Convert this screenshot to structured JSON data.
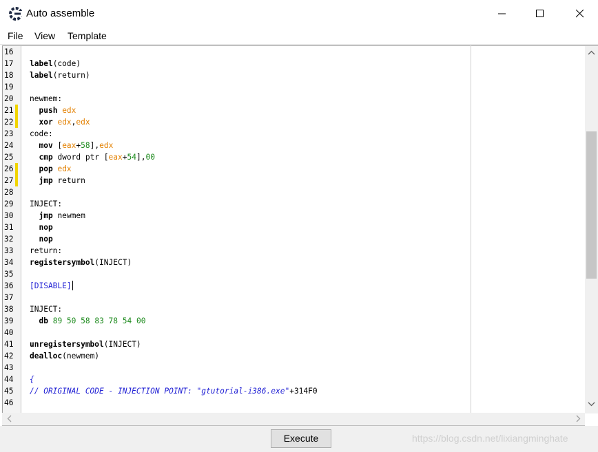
{
  "window": {
    "title": "Auto assemble",
    "min_label": "Minimize",
    "max_label": "Maximize",
    "close_label": "Close"
  },
  "menu": {
    "items": [
      {
        "label": "File"
      },
      {
        "label": "View"
      },
      {
        "label": "Template"
      }
    ]
  },
  "editor": {
    "lines": [
      {
        "n": "16",
        "mark": false,
        "tokens": []
      },
      {
        "n": "17",
        "mark": false,
        "tokens": [
          {
            "t": "kw",
            "v": "label"
          },
          {
            "t": "id",
            "v": "(code)"
          }
        ]
      },
      {
        "n": "18",
        "mark": false,
        "tokens": [
          {
            "t": "kw",
            "v": "label"
          },
          {
            "t": "id",
            "v": "(return)"
          }
        ]
      },
      {
        "n": "19",
        "mark": false,
        "tokens": []
      },
      {
        "n": "20",
        "mark": false,
        "tokens": [
          {
            "t": "id",
            "v": "newmem:"
          }
        ]
      },
      {
        "n": "21",
        "mark": true,
        "tokens": [
          {
            "t": "id",
            "v": "  "
          },
          {
            "t": "kw",
            "v": "push"
          },
          {
            "t": "id",
            "v": " "
          },
          {
            "t": "reg",
            "v": "edx"
          }
        ]
      },
      {
        "n": "22",
        "mark": true,
        "tokens": [
          {
            "t": "id",
            "v": "  "
          },
          {
            "t": "kw",
            "v": "xor"
          },
          {
            "t": "id",
            "v": " "
          },
          {
            "t": "reg",
            "v": "edx"
          },
          {
            "t": "id",
            "v": ","
          },
          {
            "t": "reg",
            "v": "edx"
          }
        ]
      },
      {
        "n": "23",
        "mark": false,
        "tokens": [
          {
            "t": "id",
            "v": "code:"
          }
        ]
      },
      {
        "n": "24",
        "mark": false,
        "tokens": [
          {
            "t": "id",
            "v": "  "
          },
          {
            "t": "kw",
            "v": "mov"
          },
          {
            "t": "id",
            "v": " ["
          },
          {
            "t": "reg",
            "v": "eax"
          },
          {
            "t": "id",
            "v": "+"
          },
          {
            "t": "num",
            "v": "58"
          },
          {
            "t": "id",
            "v": "],"
          },
          {
            "t": "reg",
            "v": "edx"
          }
        ]
      },
      {
        "n": "25",
        "mark": false,
        "tokens": [
          {
            "t": "id",
            "v": "  "
          },
          {
            "t": "kw",
            "v": "cmp"
          },
          {
            "t": "id",
            "v": " dword ptr ["
          },
          {
            "t": "reg",
            "v": "eax"
          },
          {
            "t": "id",
            "v": "+"
          },
          {
            "t": "num",
            "v": "54"
          },
          {
            "t": "id",
            "v": "],"
          },
          {
            "t": "num",
            "v": "00"
          }
        ]
      },
      {
        "n": "26",
        "mark": true,
        "tokens": [
          {
            "t": "id",
            "v": "  "
          },
          {
            "t": "kw",
            "v": "pop"
          },
          {
            "t": "id",
            "v": " "
          },
          {
            "t": "reg",
            "v": "edx"
          }
        ]
      },
      {
        "n": "27",
        "mark": true,
        "tokens": [
          {
            "t": "id",
            "v": "  "
          },
          {
            "t": "kw",
            "v": "jmp"
          },
          {
            "t": "id",
            "v": " return"
          }
        ]
      },
      {
        "n": "28",
        "mark": false,
        "tokens": []
      },
      {
        "n": "29",
        "mark": false,
        "tokens": [
          {
            "t": "id",
            "v": "INJECT:"
          }
        ]
      },
      {
        "n": "30",
        "mark": false,
        "tokens": [
          {
            "t": "id",
            "v": "  "
          },
          {
            "t": "kw",
            "v": "jmp"
          },
          {
            "t": "id",
            "v": " newmem"
          }
        ]
      },
      {
        "n": "31",
        "mark": false,
        "tokens": [
          {
            "t": "id",
            "v": "  "
          },
          {
            "t": "kw",
            "v": "nop"
          }
        ]
      },
      {
        "n": "32",
        "mark": false,
        "tokens": [
          {
            "t": "id",
            "v": "  "
          },
          {
            "t": "kw",
            "v": "nop"
          }
        ]
      },
      {
        "n": "33",
        "mark": false,
        "tokens": [
          {
            "t": "id",
            "v": "return:"
          }
        ]
      },
      {
        "n": "34",
        "mark": false,
        "tokens": [
          {
            "t": "kw",
            "v": "registersymbol"
          },
          {
            "t": "id",
            "v": "(INJECT)"
          }
        ]
      },
      {
        "n": "35",
        "mark": false,
        "tokens": []
      },
      {
        "n": "36",
        "mark": false,
        "caret": true,
        "tokens": [
          {
            "t": "sec",
            "v": "[DISABLE]"
          }
        ]
      },
      {
        "n": "37",
        "mark": false,
        "tokens": []
      },
      {
        "n": "38",
        "mark": false,
        "tokens": [
          {
            "t": "id",
            "v": "INJECT:"
          }
        ]
      },
      {
        "n": "39",
        "mark": false,
        "tokens": [
          {
            "t": "id",
            "v": "  "
          },
          {
            "t": "kw",
            "v": "db"
          },
          {
            "t": "id",
            "v": " "
          },
          {
            "t": "num",
            "v": "89 50 58 83 78 54 00"
          }
        ]
      },
      {
        "n": "40",
        "mark": false,
        "tokens": []
      },
      {
        "n": "41",
        "mark": false,
        "tokens": [
          {
            "t": "kw",
            "v": "unregistersymbol"
          },
          {
            "t": "id",
            "v": "(INJECT)"
          }
        ]
      },
      {
        "n": "42",
        "mark": false,
        "tokens": [
          {
            "t": "kw",
            "v": "dealloc"
          },
          {
            "t": "id",
            "v": "(newmem)"
          }
        ]
      },
      {
        "n": "43",
        "mark": false,
        "tokens": []
      },
      {
        "n": "44",
        "mark": false,
        "tokens": [
          {
            "t": "cmt",
            "v": "{"
          }
        ]
      },
      {
        "n": "45",
        "mark": false,
        "tokens": [
          {
            "t": "cmt",
            "v": "// ORIGINAL CODE - INJECTION POINT: "
          },
          {
            "t": "str",
            "v": "\"gtutorial-i386.exe\""
          },
          {
            "t": "id",
            "v": "+314F0"
          }
        ]
      },
      {
        "n": "46",
        "mark": false,
        "tokens": []
      }
    ]
  },
  "footer": {
    "execute_label": "Execute"
  },
  "watermark": "https://blog.csdn.net/lixiangminghate",
  "colors": {
    "register": "#e38000",
    "number": "#1c8a1c",
    "comment": "#1f1fd4",
    "change_marker": "#f1d400"
  }
}
